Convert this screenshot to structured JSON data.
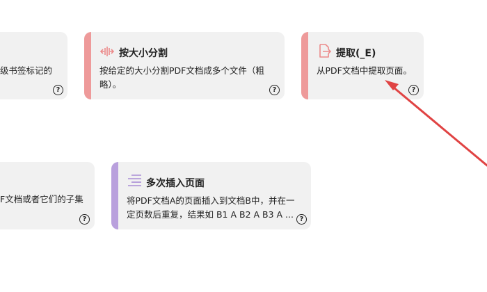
{
  "colors": {
    "card_bg": "#f1f1f1",
    "stripe_red": "#ee9a9a",
    "stripe_purple": "#b9a0dd",
    "icon_red": "#ec8a8a",
    "icon_purple": "#a98dd6",
    "arrow": "#e04343"
  },
  "cards": [
    {
      "title": "",
      "desc_line1": "级书签标记的",
      "desc_line2": "",
      "help": "?"
    },
    {
      "title": "按大小分割",
      "desc_line1": "按给定的大小分割PDF文档成多个文件（粗",
      "desc_line2": "略）。",
      "icon": "split-arrows-icon",
      "help": "?"
    },
    {
      "title": "提取(_E)",
      "desc_line1": "从PDF文档中提取页面。",
      "desc_line2": "",
      "icon": "extract-page-icon",
      "help": "?"
    },
    {
      "title": "",
      "desc_line1": "F文档或者它们的子集",
      "desc_line2": "",
      "help": "?"
    },
    {
      "title": "多次插入页面",
      "desc_line1": "将PDF文档A的页面插入到文档B中，并在一",
      "desc_line2": "定页数后重复，结果如 B1 A B2 A B3 A ...",
      "icon": "insert-lines-icon",
      "help": "?"
    }
  ]
}
